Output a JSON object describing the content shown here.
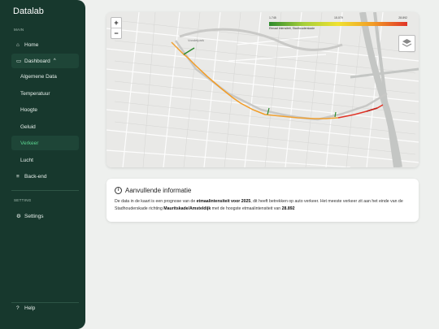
{
  "app": {
    "title": "Datalab"
  },
  "sidebar": {
    "main_label": "MAIN",
    "home": "Home",
    "dashboard": "Dashboard",
    "dashboard_items": [
      "Algemene Data",
      "Temperatuur",
      "Hoogte",
      "Geluid",
      "Verkeer",
      "Lucht"
    ],
    "active_item": "Verkeer",
    "backend": "Back-end",
    "setting_label": "SETTING",
    "settings": "Settings",
    "help": "Help"
  },
  "map": {
    "zoom_in": "+",
    "zoom_out": "−",
    "legend": {
      "min": "1.745",
      "mid": "15.079",
      "max": "28.892",
      "caption": "Etmaal intensiteit, Stadhouderskade"
    },
    "place_label": "Vondelpark",
    "colors": {
      "low": "#2e8b2e",
      "mid": "#f0c02f",
      "high": "#e03428"
    }
  },
  "info": {
    "icon": "info-icon",
    "title": "Aanvullende informatie",
    "text_1": "De data in de kaart is een prognose van de ",
    "bold_1": "etmaalintensiteit voor 2025",
    "text_2": ", dit heeft betrekken op auto verkeer. Het meeste verkeer zit aan het einde van de Stadhouderskade richting ",
    "bold_2": "Mauritskade/Amsteldijk",
    "text_3": " met de hoogste etmaalintensiteit van ",
    "bold_3": "28.892"
  }
}
